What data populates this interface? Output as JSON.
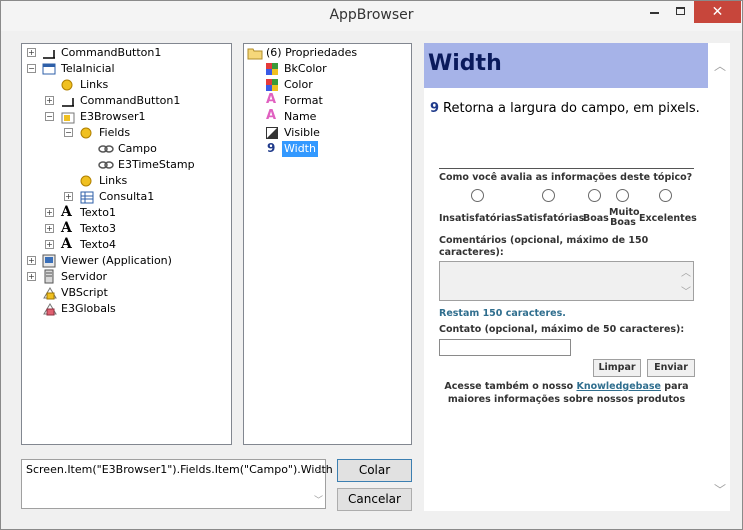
{
  "window": {
    "title": "AppBrowser",
    "close_glyph": "✕"
  },
  "tree": [
    {
      "label": "CommandButton1",
      "icon": "command-button-icon"
    },
    {
      "label": "TelaInicial",
      "icon": "screen-icon"
    },
    {
      "label": "Links",
      "icon": "links-icon"
    },
    {
      "label": "CommandButton1",
      "icon": "command-button-icon"
    },
    {
      "label": "E3Browser1",
      "icon": "e3browser-icon"
    },
    {
      "label": "Fields",
      "icon": "fields-icon"
    },
    {
      "label": "Campo",
      "icon": "field-link-icon"
    },
    {
      "label": "E3TimeStamp",
      "icon": "field-link-icon"
    },
    {
      "label": "Links",
      "icon": "links-icon"
    },
    {
      "label": "Consulta1",
      "icon": "query-icon"
    },
    {
      "label": "Texto1",
      "icon": "text-icon"
    },
    {
      "label": "Texto3",
      "icon": "text-icon"
    },
    {
      "label": "Texto4",
      "icon": "text-icon"
    },
    {
      "label": "Viewer (Application)",
      "icon": "viewer-icon"
    },
    {
      "label": "Servidor",
      "icon": "server-icon"
    },
    {
      "label": "VBScript",
      "icon": "vbscript-icon"
    },
    {
      "label": "E3Globals",
      "icon": "globals-icon"
    }
  ],
  "properties": {
    "header": "(6) Propriedades",
    "items": [
      "BkColor",
      "Color",
      "Format",
      "Name",
      "Visible",
      "Width"
    ]
  },
  "help": {
    "title": "Width",
    "type_glyph": "9",
    "description": "Retorna a largura do campo, em pixels.",
    "feedback_question": "Como você avalia as informações deste tópico?",
    "ratings": [
      "Insatisfatórias",
      "Satisfatórias",
      "Boas",
      "Muito Boas",
      "Excelentes"
    ],
    "comments_label": "Comentários (opcional, máximo de 150 caracteres):",
    "remaining": "Restam 150 caracteres.",
    "contact_label": "Contato (opcional, máximo de 50 caracteres):",
    "clear_label": "Limpar",
    "send_label": "Enviar",
    "kb_before": "Acesse também o nosso",
    "kb_link": "Knowledgebase",
    "kb_after": "para maiores informações sobre nossos produtos"
  },
  "expression": "Screen.Item(\"E3Browser1\").Fields.Item(\"Campo\").Width",
  "buttons": {
    "paste": "Colar",
    "cancel": "Cancelar"
  }
}
